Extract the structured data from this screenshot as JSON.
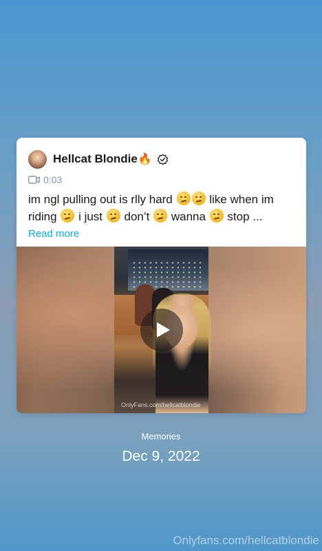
{
  "post": {
    "author_name": "Hellcat Blondie",
    "author_emoji": "🔥",
    "duration": "0:03",
    "caption": {
      "line1_part1": "im ngl pulling out is rlly hard",
      "line1_part2": "like when im",
      "line2_part1": "riding",
      "line2_part2": "i just",
      "line2_part3": "don’t",
      "line2_part4": "wanna",
      "line2_part5": "stop ..."
    },
    "read_more_label": "Read more",
    "media_watermark": "OnlyFans.com/hellcatblondie"
  },
  "memories": {
    "label": "Memories",
    "date": "Dec 9, 2022"
  },
  "watermark": "Onlyfans.com/hellcatblondie",
  "icons": {
    "verified": "verified-icon",
    "camera": "video-camera-icon",
    "play": "play-icon",
    "emoji": "woozy-face-emoji"
  },
  "colors": {
    "link": "#00aff0",
    "duration_text": "#8a96a3",
    "card_bg": "#ffffff"
  }
}
